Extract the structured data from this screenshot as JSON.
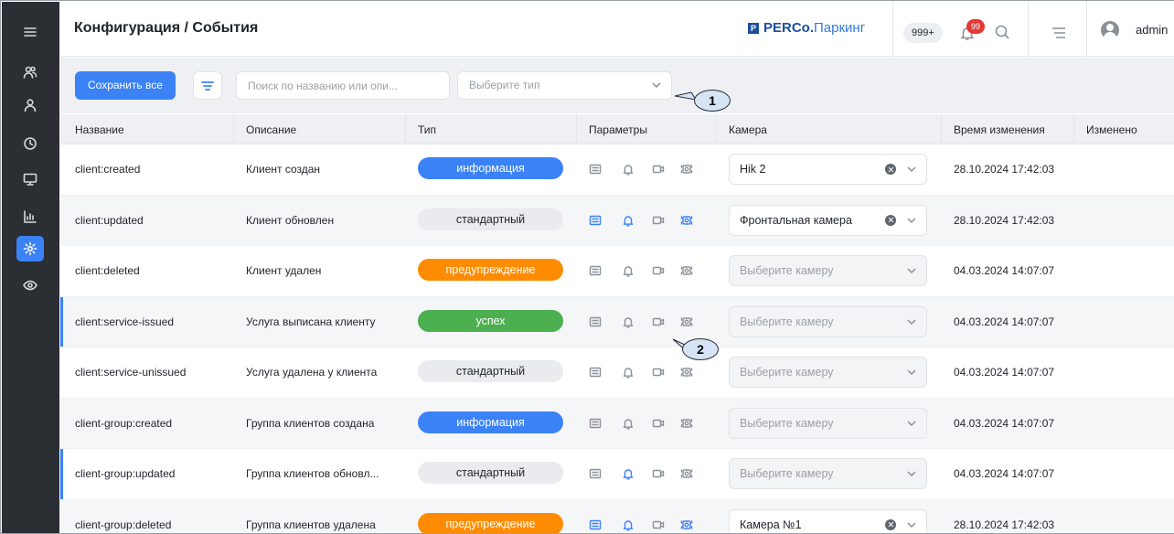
{
  "header": {
    "title": "Конфигурация / События",
    "brand_mark": "P",
    "brand_bold": "PERCo.",
    "brand_light": "Паркинг",
    "counter": "999+",
    "notifications": "99",
    "user": "admin"
  },
  "sidebar": {
    "items": [
      {
        "name": "menu-icon"
      },
      {
        "name": "users-group-icon"
      },
      {
        "name": "user-icon"
      },
      {
        "name": "history-icon"
      },
      {
        "name": "monitor-icon"
      },
      {
        "name": "reports-chart-icon"
      },
      {
        "name": "settings-gear-icon",
        "active": true
      },
      {
        "name": "eye-icon"
      }
    ]
  },
  "toolbar": {
    "save_label": "Сохранить все",
    "search_placeholder": "Поиск по названию или опи...",
    "type_placeholder": "Выберите тип"
  },
  "callouts": [
    "1",
    "2"
  ],
  "table": {
    "columns": [
      "Название",
      "Описание",
      "Тип",
      "Параметры",
      "Камера",
      "Время изменения",
      "Изменено"
    ],
    "rows": [
      {
        "name": "client:created",
        "desc": "Клиент создан",
        "type": "информация",
        "kind": "info",
        "params": [
          false,
          false,
          false,
          false
        ],
        "camera": "Hik 2",
        "camera_set": true,
        "time": "28.10.2024 17:42:03",
        "marked": false
      },
      {
        "name": "client:updated",
        "desc": "Клиент обновлен",
        "type": "стандартный",
        "kind": "std",
        "params": [
          true,
          true,
          false,
          true
        ],
        "camera": "Фронтальная камера",
        "camera_set": true,
        "time": "28.10.2024 17:42:03",
        "marked": false
      },
      {
        "name": "client:deleted",
        "desc": "Клиент удален",
        "type": "предупреждение",
        "kind": "warn",
        "params": [
          false,
          false,
          false,
          false
        ],
        "camera": "Выберите камеру",
        "camera_set": false,
        "time": "04.03.2024 14:07:07",
        "marked": false
      },
      {
        "name": "client:service-issued",
        "desc": "Услуга выписана клиенту",
        "type": "успех",
        "kind": "ok",
        "params": [
          false,
          false,
          false,
          false
        ],
        "camera": "Выберите камеру",
        "camera_set": false,
        "time": "04.03.2024 14:07:07",
        "marked": true
      },
      {
        "name": "client:service-unissued",
        "desc": "Услуга удалена у клиента",
        "type": "стандартный",
        "kind": "std",
        "params": [
          false,
          false,
          false,
          false
        ],
        "camera": "Выберите камеру",
        "camera_set": false,
        "time": "04.03.2024 14:07:07",
        "marked": false
      },
      {
        "name": "client-group:created",
        "desc": "Группа клиентов создана",
        "type": "информация",
        "kind": "info",
        "params": [
          false,
          false,
          false,
          false
        ],
        "camera": "Выберите камеру",
        "camera_set": false,
        "time": "04.03.2024 14:07:07",
        "marked": false
      },
      {
        "name": "client-group:updated",
        "desc": "Группа клиентов обновл...",
        "type": "стандартный",
        "kind": "std",
        "params": [
          false,
          true,
          false,
          false
        ],
        "camera": "Выберите камеру",
        "camera_set": false,
        "time": "04.03.2024 14:07:07",
        "marked": true
      },
      {
        "name": "client-group:deleted",
        "desc": "Группа клиентов удалена",
        "type": "предупреждение",
        "kind": "warn",
        "params": [
          true,
          true,
          false,
          true
        ],
        "camera": "Камера №1",
        "camera_set": true,
        "time": "28.10.2024 17:42:03",
        "marked": false
      }
    ]
  }
}
